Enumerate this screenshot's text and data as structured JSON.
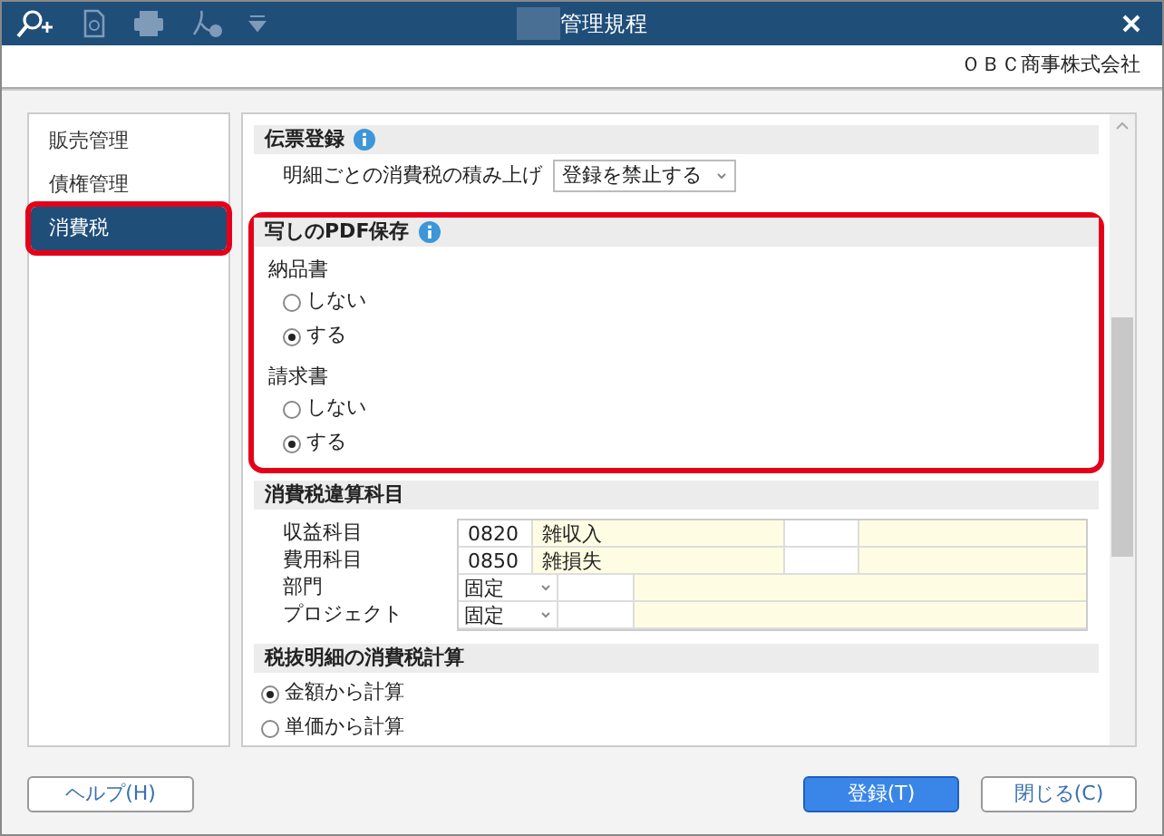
{
  "window": {
    "title": "管理規程",
    "company": "ＯＢＣ商事株式会社"
  },
  "sidebar": {
    "items": [
      {
        "label": "販売管理",
        "selected": false,
        "highlighted": false
      },
      {
        "label": "債権管理",
        "selected": false,
        "highlighted": false
      },
      {
        "label": "消費税",
        "selected": true,
        "highlighted": true
      }
    ]
  },
  "sections": [
    {
      "kind": "select",
      "title": "伝票登録",
      "info": true,
      "highlighted": false,
      "label": "明細ごとの消費税の積み上げ",
      "value": "登録を禁止する"
    },
    {
      "kind": "radiogroups",
      "title": "写しのPDF保存",
      "info": true,
      "highlighted": true,
      "groups": [
        {
          "label": "納品書",
          "options": [
            {
              "label": "しない",
              "selected": false
            },
            {
              "label": "する",
              "selected": true
            }
          ]
        },
        {
          "label": "請求書",
          "options": [
            {
              "label": "しない",
              "selected": false
            },
            {
              "label": "する",
              "selected": true
            }
          ]
        }
      ]
    },
    {
      "kind": "accounts",
      "title": "消費税違算科目",
      "info": false,
      "highlighted": false,
      "rows": [
        {
          "kind": "code",
          "label": "収益科目",
          "code": "0820",
          "name": "雑収入"
        },
        {
          "kind": "code",
          "label": "費用科目",
          "code": "0850",
          "name": "雑損失"
        },
        {
          "kind": "select",
          "label": "部門",
          "value": "固定"
        },
        {
          "kind": "select",
          "label": "プロジェクト",
          "value": "固定"
        }
      ]
    },
    {
      "kind": "radios",
      "title": "税抜明細の消費税計算",
      "info": false,
      "highlighted": false,
      "options": [
        {
          "label": "金額から計算",
          "selected": true
        },
        {
          "label": "単価から計算",
          "selected": false
        }
      ]
    }
  ],
  "buttons": [
    {
      "label": "ヘルプ(H)",
      "kind": "help"
    },
    {
      "label": "登録(T)",
      "kind": "primary"
    },
    {
      "label": "閉じる(C)",
      "kind": "normal"
    }
  ]
}
